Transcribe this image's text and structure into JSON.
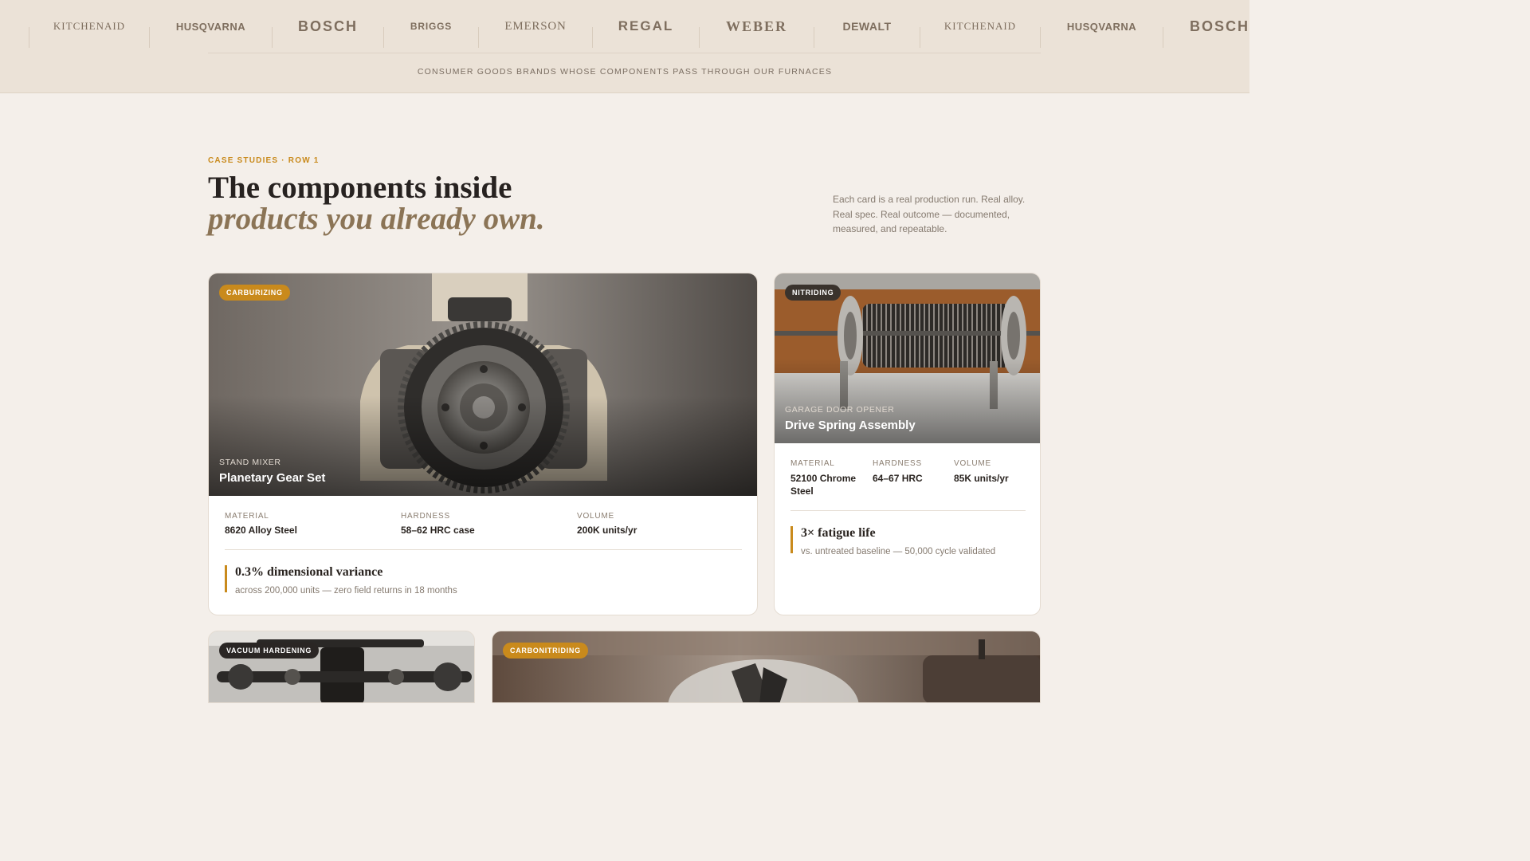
{
  "brand_strip": {
    "logos": [
      "KITCHENAID",
      "HUSQVARNA",
      "BOSCH",
      "BRIGGS",
      "EMERSON",
      "REGAL",
      "WEBER",
      "DEWALT",
      "KITCHENAID",
      "HUSQVARNA",
      "BOSCH"
    ],
    "caption": "CONSUMER GOODS BRANDS WHOSE COMPONENTS PASS THROUGH OUR FURNACES"
  },
  "section": {
    "eyebrow": "CASE STUDIES · ROW 1",
    "heading_line1": "The components inside",
    "heading_line2": "products you already own.",
    "intro": "Each card is a real production run. Real alloy. Real spec. Real outcome — documented, measured, and repeatable."
  },
  "cards": [
    {
      "badge": "CARBURIZING",
      "category": "STAND MIXER",
      "title": "Planetary Gear Set",
      "specs": [
        {
          "label": "MATERIAL",
          "value": "8620 Alloy Steel"
        },
        {
          "label": "HARDNESS",
          "value": "58–62 HRC case"
        },
        {
          "label": "VOLUME",
          "value": "200K units/yr"
        }
      ],
      "outcome_title": "0.3% dimensional variance",
      "outcome_sub": "across 200,000 units — zero field returns in 18 months"
    },
    {
      "badge": "NITRIDING",
      "category": "GARAGE DOOR OPENER",
      "title": "Drive Spring Assembly",
      "specs": [
        {
          "label": "MATERIAL",
          "value": "52100 Chrome Steel"
        },
        {
          "label": "HARDNESS",
          "value": "64–67 HRC"
        },
        {
          "label": "VOLUME",
          "value": "85K units/yr"
        }
      ],
      "outcome_title": "3× fatigue life",
      "outcome_sub": "vs. untreated baseline — 50,000 cycle validated"
    },
    {
      "badge": "VACUUM HARDENING"
    },
    {
      "badge": "CARBONITRIDING"
    }
  ],
  "colors": {
    "accent": "#c98a1c",
    "strip_bg": "#ebe2d7",
    "page_bg": "#f4efea",
    "heading_italic": "#8b7456"
  }
}
